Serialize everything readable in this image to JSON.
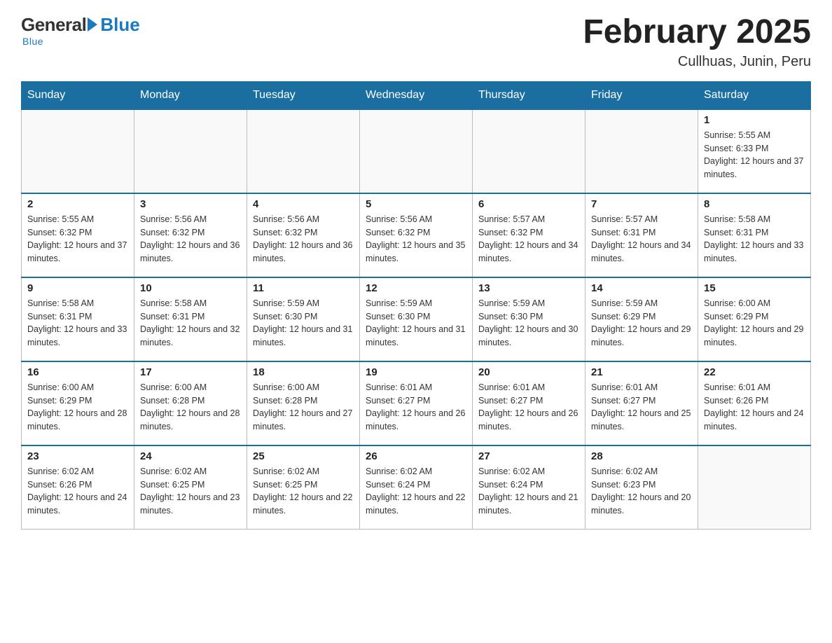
{
  "logo": {
    "general": "General",
    "blue": "Blue"
  },
  "title": {
    "month_year": "February 2025",
    "location": "Cullhuas, Junin, Peru"
  },
  "days_of_week": [
    "Sunday",
    "Monday",
    "Tuesday",
    "Wednesday",
    "Thursday",
    "Friday",
    "Saturday"
  ],
  "weeks": [
    [
      {
        "day": "",
        "info": ""
      },
      {
        "day": "",
        "info": ""
      },
      {
        "day": "",
        "info": ""
      },
      {
        "day": "",
        "info": ""
      },
      {
        "day": "",
        "info": ""
      },
      {
        "day": "",
        "info": ""
      },
      {
        "day": "1",
        "info": "Sunrise: 5:55 AM\nSunset: 6:33 PM\nDaylight: 12 hours and 37 minutes."
      }
    ],
    [
      {
        "day": "2",
        "info": "Sunrise: 5:55 AM\nSunset: 6:32 PM\nDaylight: 12 hours and 37 minutes."
      },
      {
        "day": "3",
        "info": "Sunrise: 5:56 AM\nSunset: 6:32 PM\nDaylight: 12 hours and 36 minutes."
      },
      {
        "day": "4",
        "info": "Sunrise: 5:56 AM\nSunset: 6:32 PM\nDaylight: 12 hours and 36 minutes."
      },
      {
        "day": "5",
        "info": "Sunrise: 5:56 AM\nSunset: 6:32 PM\nDaylight: 12 hours and 35 minutes."
      },
      {
        "day": "6",
        "info": "Sunrise: 5:57 AM\nSunset: 6:32 PM\nDaylight: 12 hours and 34 minutes."
      },
      {
        "day": "7",
        "info": "Sunrise: 5:57 AM\nSunset: 6:31 PM\nDaylight: 12 hours and 34 minutes."
      },
      {
        "day": "8",
        "info": "Sunrise: 5:58 AM\nSunset: 6:31 PM\nDaylight: 12 hours and 33 minutes."
      }
    ],
    [
      {
        "day": "9",
        "info": "Sunrise: 5:58 AM\nSunset: 6:31 PM\nDaylight: 12 hours and 33 minutes."
      },
      {
        "day": "10",
        "info": "Sunrise: 5:58 AM\nSunset: 6:31 PM\nDaylight: 12 hours and 32 minutes."
      },
      {
        "day": "11",
        "info": "Sunrise: 5:59 AM\nSunset: 6:30 PM\nDaylight: 12 hours and 31 minutes."
      },
      {
        "day": "12",
        "info": "Sunrise: 5:59 AM\nSunset: 6:30 PM\nDaylight: 12 hours and 31 minutes."
      },
      {
        "day": "13",
        "info": "Sunrise: 5:59 AM\nSunset: 6:30 PM\nDaylight: 12 hours and 30 minutes."
      },
      {
        "day": "14",
        "info": "Sunrise: 5:59 AM\nSunset: 6:29 PM\nDaylight: 12 hours and 29 minutes."
      },
      {
        "day": "15",
        "info": "Sunrise: 6:00 AM\nSunset: 6:29 PM\nDaylight: 12 hours and 29 minutes."
      }
    ],
    [
      {
        "day": "16",
        "info": "Sunrise: 6:00 AM\nSunset: 6:29 PM\nDaylight: 12 hours and 28 minutes."
      },
      {
        "day": "17",
        "info": "Sunrise: 6:00 AM\nSunset: 6:28 PM\nDaylight: 12 hours and 28 minutes."
      },
      {
        "day": "18",
        "info": "Sunrise: 6:00 AM\nSunset: 6:28 PM\nDaylight: 12 hours and 27 minutes."
      },
      {
        "day": "19",
        "info": "Sunrise: 6:01 AM\nSunset: 6:27 PM\nDaylight: 12 hours and 26 minutes."
      },
      {
        "day": "20",
        "info": "Sunrise: 6:01 AM\nSunset: 6:27 PM\nDaylight: 12 hours and 26 minutes."
      },
      {
        "day": "21",
        "info": "Sunrise: 6:01 AM\nSunset: 6:27 PM\nDaylight: 12 hours and 25 minutes."
      },
      {
        "day": "22",
        "info": "Sunrise: 6:01 AM\nSunset: 6:26 PM\nDaylight: 12 hours and 24 minutes."
      }
    ],
    [
      {
        "day": "23",
        "info": "Sunrise: 6:02 AM\nSunset: 6:26 PM\nDaylight: 12 hours and 24 minutes."
      },
      {
        "day": "24",
        "info": "Sunrise: 6:02 AM\nSunset: 6:25 PM\nDaylight: 12 hours and 23 minutes."
      },
      {
        "day": "25",
        "info": "Sunrise: 6:02 AM\nSunset: 6:25 PM\nDaylight: 12 hours and 22 minutes."
      },
      {
        "day": "26",
        "info": "Sunrise: 6:02 AM\nSunset: 6:24 PM\nDaylight: 12 hours and 22 minutes."
      },
      {
        "day": "27",
        "info": "Sunrise: 6:02 AM\nSunset: 6:24 PM\nDaylight: 12 hours and 21 minutes."
      },
      {
        "day": "28",
        "info": "Sunrise: 6:02 AM\nSunset: 6:23 PM\nDaylight: 12 hours and 20 minutes."
      },
      {
        "day": "",
        "info": ""
      }
    ]
  ]
}
